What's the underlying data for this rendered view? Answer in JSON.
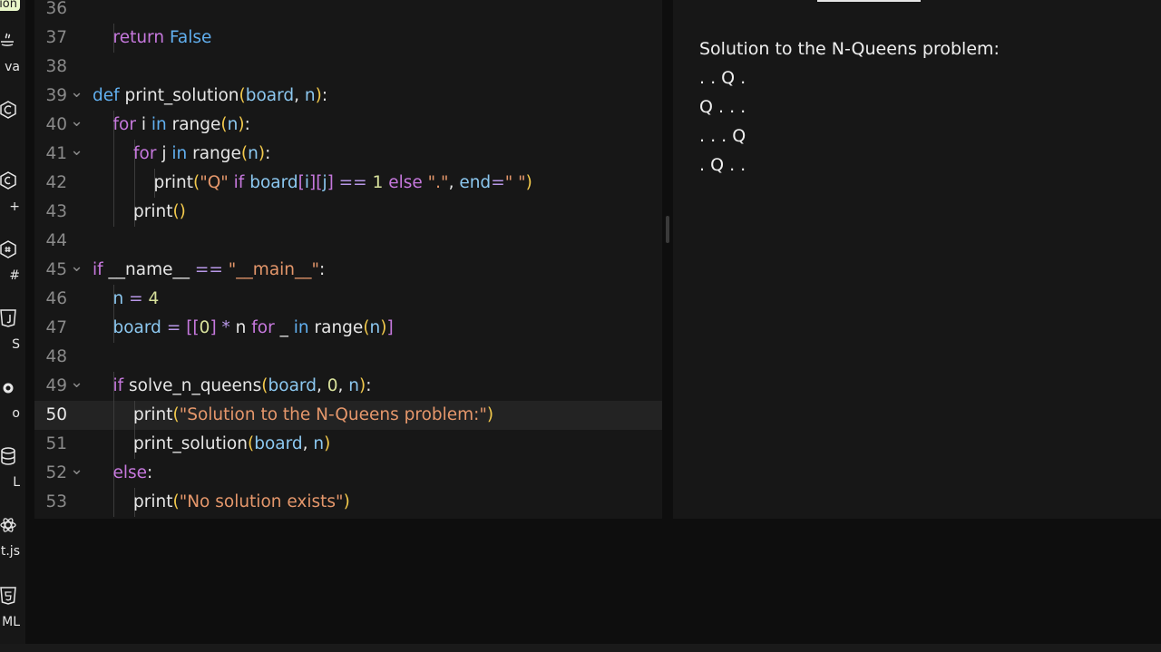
{
  "sidebar": {
    "active_tag": "ion",
    "items": [
      {
        "label": "va",
        "icon": "java-icon"
      },
      {
        "label": "",
        "icon": "c-icon"
      },
      {
        "label": "+",
        "icon": "cpp-icon"
      },
      {
        "label": "#",
        "icon": "csharp-icon"
      },
      {
        "label": "S",
        "icon": "javascript-icon"
      },
      {
        "label": "o",
        "icon": "go-icon"
      },
      {
        "label": "L",
        "icon": "sql-icon"
      },
      {
        "label": "ct.js",
        "icon": "react-icon"
      },
      {
        "label": "ML",
        "icon": "html-icon"
      }
    ]
  },
  "editor": {
    "active_line": "50",
    "lines": [
      {
        "n": "36",
        "fold": false,
        "indent": 0,
        "tokens": []
      },
      {
        "n": "37",
        "fold": false,
        "indent": 1,
        "tokens": [
          [
            "kw",
            "return"
          ],
          [
            "",
            ""
          ],
          [
            "kw2",
            " False"
          ]
        ]
      },
      {
        "n": "38",
        "fold": false,
        "indent": 0,
        "tokens": []
      },
      {
        "n": "39",
        "fold": true,
        "indent": 0,
        "tokens": [
          [
            "kw2",
            "def"
          ],
          [
            "",
            " print_solution"
          ],
          [
            "par",
            "("
          ],
          [
            "var",
            "board"
          ],
          [
            "",
            ", "
          ],
          [
            "var",
            "n"
          ],
          [
            "par",
            ")"
          ],
          [
            "",
            ":"
          ]
        ]
      },
      {
        "n": "40",
        "fold": true,
        "indent": 1,
        "tokens": [
          [
            "kw",
            "for"
          ],
          [
            "",
            " i "
          ],
          [
            "kw2",
            "in"
          ],
          [
            "",
            " range"
          ],
          [
            "par",
            "("
          ],
          [
            "var",
            "n"
          ],
          [
            "par",
            ")"
          ],
          [
            "",
            ":"
          ]
        ]
      },
      {
        "n": "41",
        "fold": true,
        "indent": 2,
        "tokens": [
          [
            "kw",
            "for"
          ],
          [
            "",
            " j "
          ],
          [
            "kw2",
            "in"
          ],
          [
            "",
            " range"
          ],
          [
            "par",
            "("
          ],
          [
            "var",
            "n"
          ],
          [
            "par",
            ")"
          ],
          [
            "",
            ":"
          ]
        ]
      },
      {
        "n": "42",
        "fold": false,
        "indent": 3,
        "tokens": [
          [
            "",
            "print"
          ],
          [
            "par",
            "("
          ],
          [
            "str",
            "\"Q\""
          ],
          [
            "kw",
            " if"
          ],
          [
            "var",
            " board"
          ],
          [
            "par2",
            "["
          ],
          [
            "var",
            "i"
          ],
          [
            "par2",
            "]["
          ],
          [
            "var",
            "j"
          ],
          [
            "par2",
            "]"
          ],
          [
            "op",
            " =="
          ],
          [
            "num",
            " 1"
          ],
          [
            "kw",
            " else"
          ],
          [
            "str",
            " \".\""
          ],
          [
            "",
            ", "
          ],
          [
            "var",
            "end"
          ],
          [
            "op",
            "="
          ],
          [
            "str",
            "\" \""
          ],
          [
            "par",
            ")"
          ]
        ]
      },
      {
        "n": "43",
        "fold": false,
        "indent": 2,
        "tokens": [
          [
            "",
            "print"
          ],
          [
            "par",
            "()"
          ]
        ]
      },
      {
        "n": "44",
        "fold": false,
        "indent": 0,
        "tokens": []
      },
      {
        "n": "45",
        "fold": true,
        "indent": 0,
        "tokens": [
          [
            "kw",
            "if"
          ],
          [
            "",
            " __name__ "
          ],
          [
            "op",
            "=="
          ],
          [
            "str",
            " \"__main__\""
          ],
          [
            "",
            ":"
          ]
        ]
      },
      {
        "n": "46",
        "fold": false,
        "indent": 1,
        "tokens": [
          [
            "var",
            "n"
          ],
          [
            "op",
            " ="
          ],
          [
            "num",
            " 4"
          ]
        ]
      },
      {
        "n": "47",
        "fold": false,
        "indent": 1,
        "tokens": [
          [
            "var",
            "board"
          ],
          [
            "op",
            " ="
          ],
          [
            "par2",
            " [["
          ],
          [
            "num",
            "0"
          ],
          [
            "par2",
            "]"
          ],
          [
            "op",
            " *"
          ],
          [
            "",
            " n "
          ],
          [
            "kw",
            "for"
          ],
          [
            "",
            " _ "
          ],
          [
            "kw2",
            "in"
          ],
          [
            "",
            " range"
          ],
          [
            "par",
            "("
          ],
          [
            "var",
            "n"
          ],
          [
            "par",
            ")"
          ],
          [
            "par2",
            "]"
          ]
        ]
      },
      {
        "n": "48",
        "fold": false,
        "indent": 0,
        "tokens": []
      },
      {
        "n": "49",
        "fold": true,
        "indent": 1,
        "tokens": [
          [
            "kw",
            "if"
          ],
          [
            "",
            " solve_n_queens"
          ],
          [
            "par",
            "("
          ],
          [
            "var",
            "board"
          ],
          [
            "",
            ", "
          ],
          [
            "num",
            "0"
          ],
          [
            "",
            ", "
          ],
          [
            "var",
            "n"
          ],
          [
            "par",
            ")"
          ],
          [
            "",
            ":"
          ]
        ]
      },
      {
        "n": "50",
        "fold": false,
        "indent": 2,
        "tokens": [
          [
            "",
            "print"
          ],
          [
            "par",
            "("
          ],
          [
            "str",
            "\"Solution to the N-Queens problem:\""
          ],
          [
            "par",
            ")"
          ]
        ]
      },
      {
        "n": "51",
        "fold": false,
        "indent": 2,
        "tokens": [
          [
            "",
            "print_solution"
          ],
          [
            "par",
            "("
          ],
          [
            "var",
            "board"
          ],
          [
            "",
            ", "
          ],
          [
            "var",
            "n"
          ],
          [
            "par",
            ")"
          ]
        ]
      },
      {
        "n": "52",
        "fold": true,
        "indent": 1,
        "tokens": [
          [
            "kw",
            "else"
          ],
          [
            "",
            ":"
          ]
        ]
      },
      {
        "n": "53",
        "fold": false,
        "indent": 2,
        "tokens": [
          [
            "",
            "print"
          ],
          [
            "par",
            "("
          ],
          [
            "str",
            "\"No solution exists\""
          ],
          [
            "par",
            ")"
          ]
        ]
      }
    ]
  },
  "output": {
    "lines": [
      "Solution to the N-Queens problem:",
      ". . Q .",
      "Q . . .",
      ". . . Q",
      ". Q . ."
    ]
  },
  "colors": {
    "background": "#0e0e0e",
    "panel": "#171717",
    "active_line": "#232323",
    "keyword": "#c678dd",
    "keyword_alt": "#61afef",
    "string": "#e5976b",
    "number": "#d7e09b",
    "paren": "#f2c94c",
    "variable": "#8cc8f0",
    "sidebar_active_tag": "#e8f7c9"
  }
}
